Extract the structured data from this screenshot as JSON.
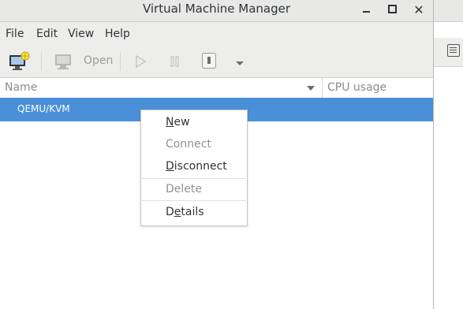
{
  "window": {
    "title": "Virtual Machine Manager"
  },
  "menubar": {
    "items": [
      "File",
      "Edit",
      "View",
      "Help"
    ]
  },
  "toolbar": {
    "new_vm_icon": "new-vm-icon",
    "open_icon": "monitor-icon",
    "open_label": "Open",
    "run_icon": "play-icon",
    "pause_icon": "pause-icon",
    "shutdown_icon": "shutdown-icon",
    "dropdown_icon": "chevron-down-icon"
  },
  "columns": {
    "name": "Name",
    "cpu": "CPU usage"
  },
  "connections": [
    {
      "label": "QEMU/KVM",
      "selected": true
    }
  ],
  "context_menu": {
    "items": [
      {
        "label": "New",
        "underline": "N",
        "enabled": true
      },
      {
        "label": "Connect",
        "enabled": false
      },
      {
        "label": "Disconnect",
        "underline": "D",
        "enabled": true
      },
      {
        "label": "Delete",
        "enabled": false
      },
      {
        "label": "Details",
        "underline": "e",
        "enabled": true
      }
    ]
  },
  "colors": {
    "selection": "#4a90d9",
    "toolbar_bg": "#ededec",
    "disabled_text": "#8f918d"
  }
}
